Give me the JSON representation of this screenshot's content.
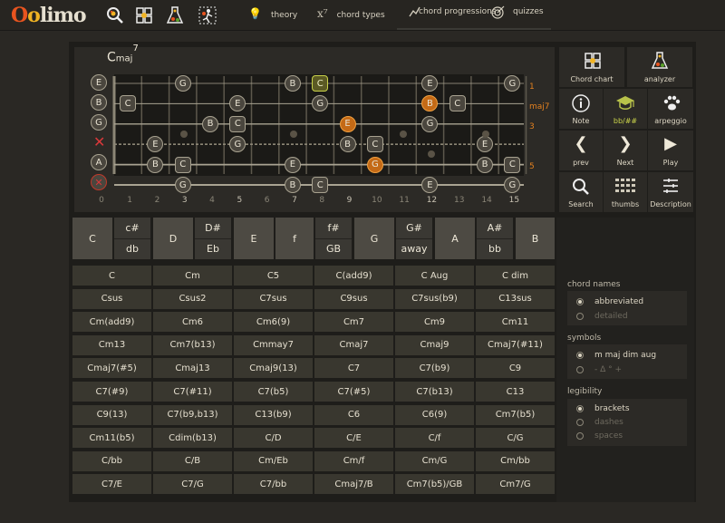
{
  "app": {
    "logo_o1": "O",
    "logo_o2": "o",
    "logo_rest": "limo"
  },
  "nav": {
    "theory": "theory",
    "theory_icon": "💡",
    "chord_types": "chord types",
    "chord_types_icon": "x⁷",
    "chord_progressions": "chord progressions",
    "quizzes": "quizzes"
  },
  "chord": {
    "root": "C",
    "quality": "maj",
    "ext": "7"
  },
  "fretboard": {
    "string_labels": [
      "E",
      "B",
      "G",
      "D",
      "A",
      "E"
    ],
    "right_labels": [
      "1",
      "maj7",
      "3",
      "",
      "5",
      ""
    ],
    "fret_numbers": [
      "0",
      "1",
      "2",
      "3",
      "4",
      "5",
      "6",
      "7",
      "8",
      "9",
      "10",
      "11",
      "12",
      "13",
      "14",
      "15"
    ]
  },
  "side_buttons": {
    "chord_chart": "Chord chart",
    "analyzer": "analyzer",
    "note": "Note",
    "bb_sharp": "bb/##",
    "arpeggio": "arpeggio",
    "prev": "prev",
    "next": "Next",
    "play": "Play",
    "search": "Search",
    "thumbs": "thumbs",
    "description": "Description"
  },
  "notes": {
    "c": "C",
    "cs": "c#",
    "db": "db",
    "d": "D",
    "ds": "D#",
    "eb": "Eb",
    "e": "E",
    "f": "f",
    "fs": "f#",
    "gb": "GB",
    "g": "G",
    "gs": "G#",
    "away": "away",
    "a": "A",
    "as": "A#",
    "bb": "bb",
    "b": "B"
  },
  "chords": {
    "r0": [
      "C",
      "Cm",
      "C5",
      "C(add9)",
      "C Aug",
      "C dim"
    ],
    "r1": [
      "Csus",
      "Csus2",
      "C7sus",
      "C9sus",
      "C7sus(b9)",
      "C13sus"
    ],
    "r2": [
      "Cm(add9)",
      "Cm6",
      "Cm6(9)",
      "Cm7",
      "Cm9",
      "Cm11"
    ],
    "r3": [
      "Cm13",
      "Cm7(b13)",
      "Cmmay7",
      "Cmaj7",
      "Cmaj9",
      "Cmaj7(#11)"
    ],
    "r4": [
      "Cmaj7(#5)",
      "Cmaj13",
      "Cmaj9(13)",
      "C7",
      "C7(b9)",
      "C9"
    ],
    "r5": [
      "C7(#9)",
      "C7(#11)",
      "C7(b5)",
      "C7(#5)",
      "C7(b13)",
      "C13"
    ],
    "r6": [
      "C9(13)",
      "C7(b9,b13)",
      "C13(b9)",
      "C6",
      "C6(9)",
      "Cm7(b5)"
    ],
    "r7": [
      "Cm11(b5)",
      "Cdim(b13)",
      "C/D",
      "C/E",
      "C/f",
      "C/G"
    ],
    "r8": [
      "C/bb",
      "C/B",
      "Cm/Eb",
      "Cm/f",
      "Cm/G",
      "Cm/bb"
    ],
    "r9": [
      "C7/E",
      "C7/G",
      "C7/bb",
      "Cmaj7/B",
      "Cm7(b5)/GB",
      "Cm7/G"
    ]
  },
  "options": {
    "chord_names": {
      "title": "chord names",
      "items": [
        "abbreviated",
        "detailed"
      ],
      "selected": "abbreviated"
    },
    "symbols": {
      "title": "symbols",
      "items": [
        "m maj dim aug",
        "- Δ ° +"
      ],
      "selected": "m maj dim aug"
    },
    "legibility": {
      "title": "legibility",
      "items": [
        "brackets",
        "dashes",
        "spaces"
      ],
      "selected": "brackets"
    }
  },
  "colors": {
    "accent_orange": "#e2801f",
    "highlight_green": "#c9d24a",
    "background": "#2a2824"
  }
}
